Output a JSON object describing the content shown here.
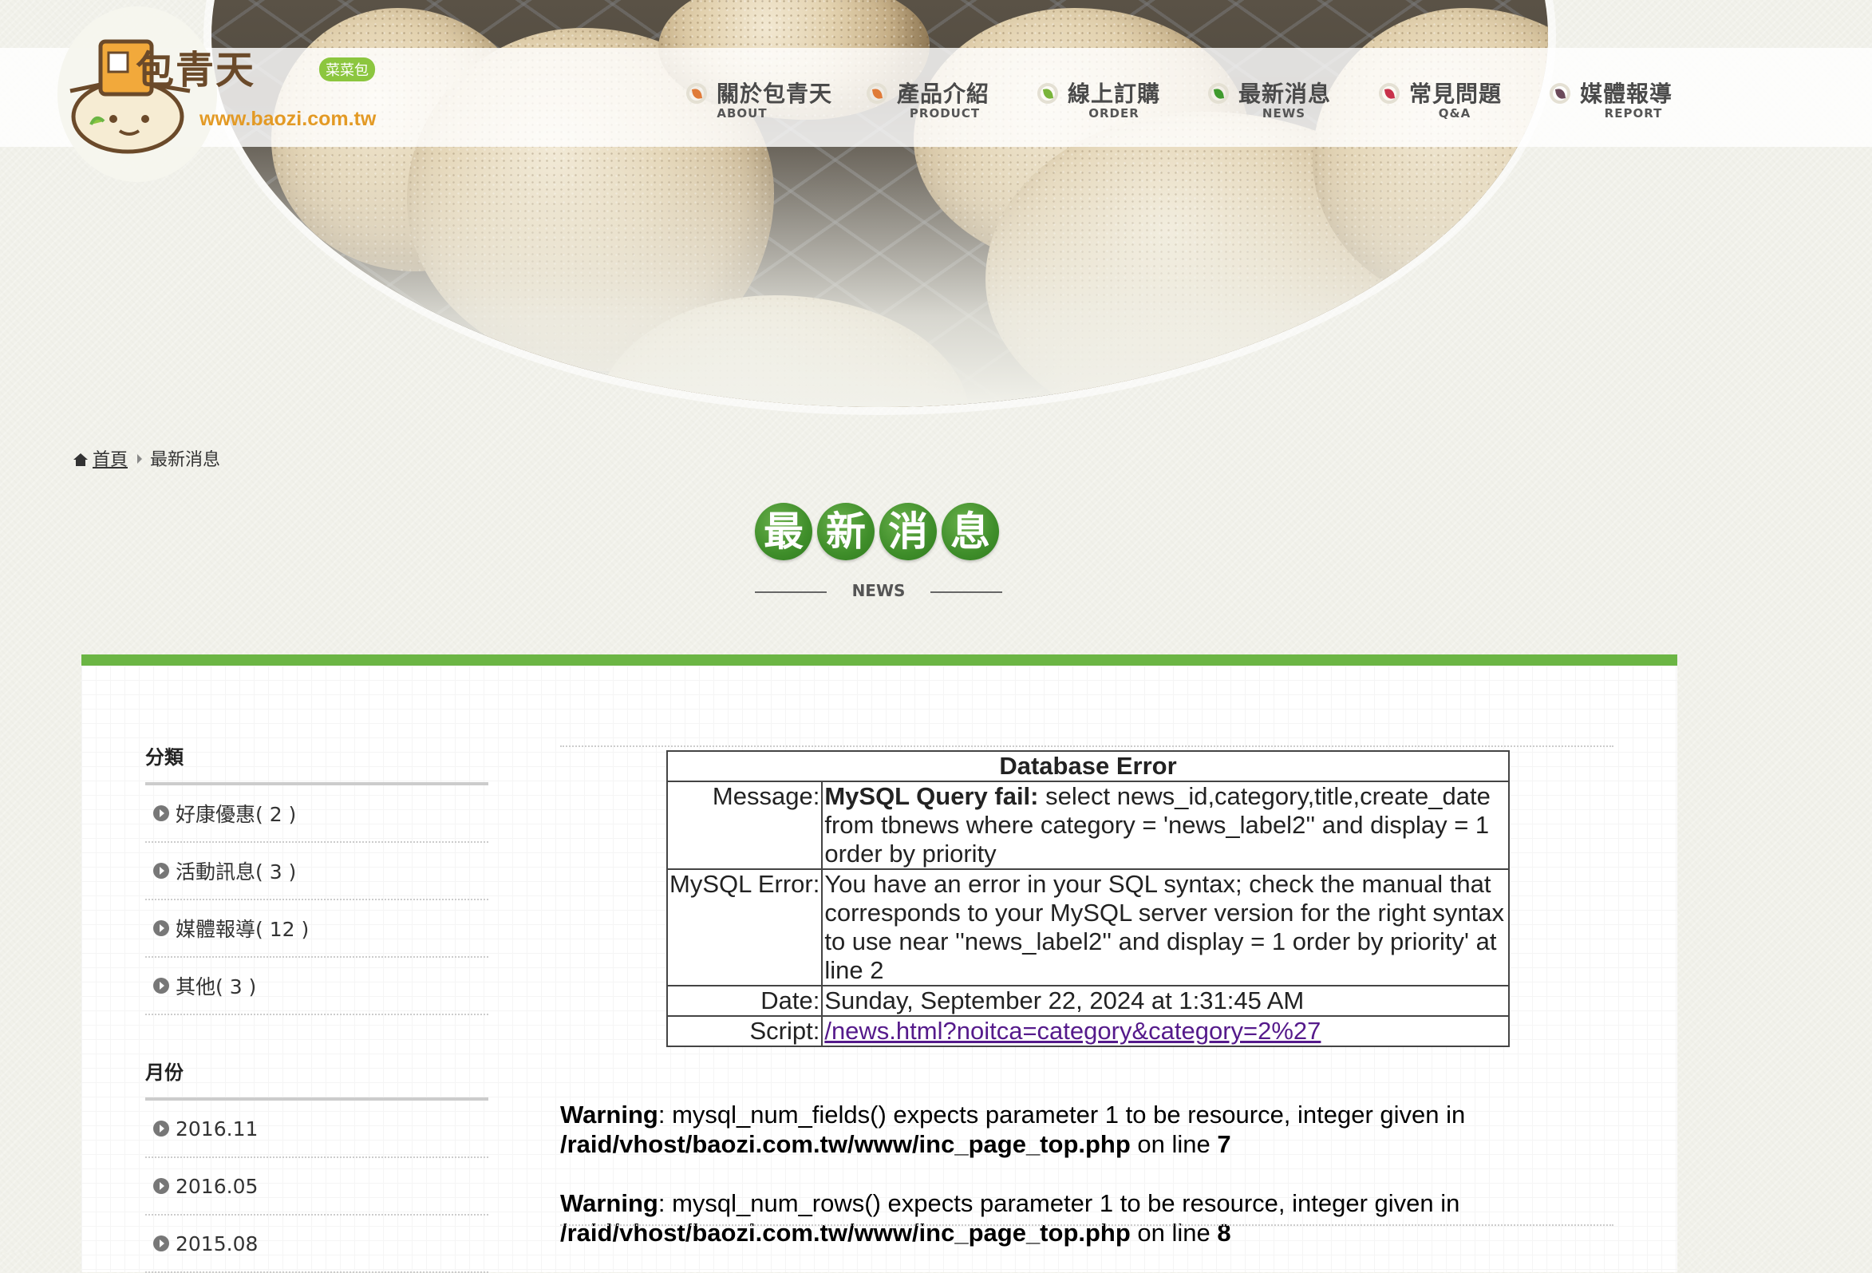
{
  "brand": {
    "name": "包青天",
    "tag": "菜菜包",
    "url": "www.baozi.com.tw"
  },
  "nav": [
    {
      "zh": "關於包青天",
      "en": "ABOUT",
      "color": "#e07b39"
    },
    {
      "zh": "產品介紹",
      "en": "PRODUCT",
      "color": "#e07b39"
    },
    {
      "zh": "線上訂購",
      "en": "ORDER",
      "color": "#79b43a"
    },
    {
      "zh": "最新消息",
      "en": "NEWS",
      "color": "#3f9a2e"
    },
    {
      "zh": "常見問題",
      "en": "Q&A",
      "color": "#c8324b"
    },
    {
      "zh": "媒體報導",
      "en": "REPORT",
      "color": "#6b4a5a"
    }
  ],
  "breadcrumb": {
    "home": "首頁",
    "current": "最新消息"
  },
  "heading": {
    "chars": [
      "最",
      "新",
      "消",
      "息"
    ],
    "sub": "NEWS"
  },
  "sidebar": {
    "category_title": "分類",
    "categories": [
      "好康優惠( 2 )",
      "活動訊息( 3 )",
      "媒體報導( 12 )",
      "其他( 3 )"
    ],
    "month_title": "月份",
    "months": [
      "2016.11",
      "2016.05",
      "2015.08"
    ]
  },
  "db_error": {
    "title": "Database Error",
    "message_label": "Message:",
    "message_bold": "MySQL Query fail:",
    "message_text": " select news_id,category,title,create_date from tbnews where category = 'news_label2'' and display = 1 order by priority",
    "mysql_error_label": "MySQL Error:",
    "mysql_error_text": "You have an error in your SQL syntax; check the manual that corresponds to your MySQL server version for the right syntax to use near ''news_label2'' and display = 1 order by priority' at line 2",
    "date_label": "Date:",
    "date_text": "Sunday, September 22, 2024 at 1:31:45 AM",
    "script_label": "Script:",
    "script_link": "/news.html?noitca=category&category=2%27"
  },
  "warnings": [
    {
      "label": "Warning",
      "message": ": mysql_num_fields() expects parameter 1 to be resource, integer given in ",
      "file": "/raid/vhost/baozi.com.tw/www/inc_page_top.php",
      "on_line": " on line ",
      "line": "7"
    },
    {
      "label": "Warning",
      "message": ": mysql_num_rows() expects parameter 1 to be resource, integer given in ",
      "file": "/raid/vhost/baozi.com.tw/www/inc_page_top.php",
      "on_line": " on line ",
      "line": "8"
    }
  ],
  "colors": {
    "accent_green": "#6bb544",
    "heading_green": "#3f8e2a",
    "logo_brown": "#6b4a2a",
    "logo_orange": "#e39a25",
    "link_purple": "#551a8b"
  }
}
